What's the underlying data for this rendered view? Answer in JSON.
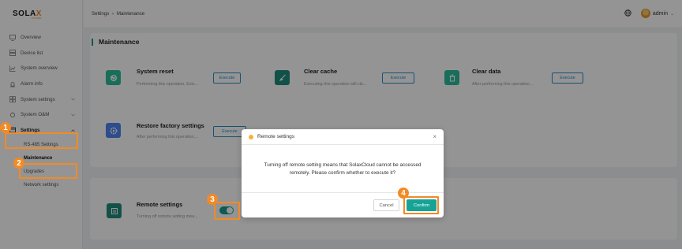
{
  "brand": {
    "logo_main": "SOLA",
    "logo_x": "X",
    "logo_sub": "POWER"
  },
  "header": {
    "breadcrumb_root": "Settings",
    "breadcrumb_sep": "»",
    "breadcrumb_current": "Maintenance",
    "user": "admin",
    "user_chevron": "⌄"
  },
  "sidebar": {
    "items": [
      {
        "label": "Overview",
        "icon": "monitor-icon"
      },
      {
        "label": "Device list",
        "icon": "device-list-icon"
      },
      {
        "label": "System overview",
        "icon": "chart-icon"
      },
      {
        "label": "Alarm info",
        "icon": "alarm-icon"
      },
      {
        "label": "System settings",
        "icon": "grid-icon"
      },
      {
        "label": "System O&M",
        "icon": "wrench-icon"
      },
      {
        "label": "Settings",
        "icon": "settings-icon"
      }
    ],
    "sub_items": [
      "RS-485 Settings",
      "Maintenance",
      "Upgrades",
      "Network settings"
    ]
  },
  "maintenance": {
    "section_title": "Maintenance",
    "tiles": [
      {
        "title": "System reset",
        "desc": "Performing this operation, Exis...",
        "button": "Execute"
      },
      {
        "title": "Clear cache",
        "desc": "Executing this operation will cle...",
        "button": "Execute"
      },
      {
        "title": "Clear data",
        "desc": "After performing this operation,...",
        "button": "Execute"
      },
      {
        "title": "Restore factory settings",
        "desc": "After performing this operation,...",
        "button": "Execute"
      }
    ]
  },
  "remote": {
    "title": "Remote settings",
    "desc": "Turning off remote setting mea...",
    "enabled": true
  },
  "dialog": {
    "title": "Remote settings",
    "close": "×",
    "message_line1": "Turning off remote setting means that SolaxCloud cannot be accessed",
    "message_line2": "remotely. Please confirm whether to execute it?",
    "cancel": "Cancel",
    "confirm": "Confirm"
  },
  "annotations": [
    "1",
    "2",
    "3",
    "4"
  ],
  "colors": {
    "accent": "#1a9c8c",
    "annotation": "#f28a26",
    "execute_border": "#2a8ec7"
  }
}
